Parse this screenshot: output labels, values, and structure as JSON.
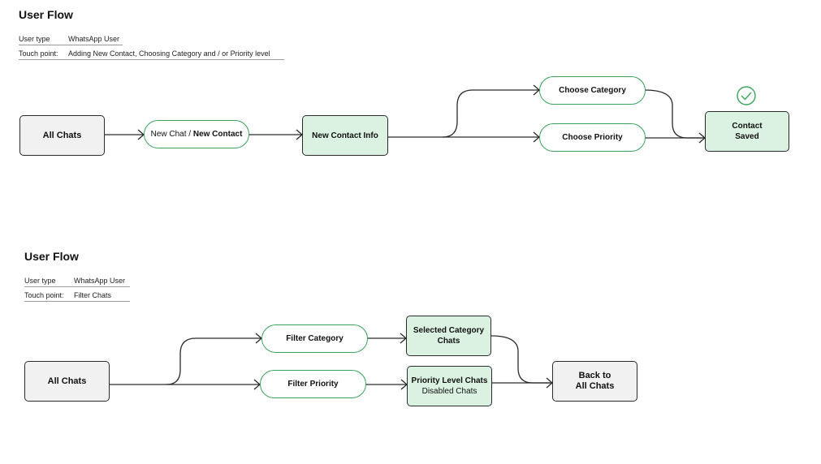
{
  "flows": [
    {
      "title": "User Flow",
      "user_type_label": "User type",
      "user_type_value": "WhatsApp User",
      "touch_point_label": "Touch point:",
      "touch_point_value": "Adding New Contact, Choosing Category and / or Priority level",
      "nodes": {
        "all_chats": "All Chats",
        "new_chat_prefix": "New Chat / ",
        "new_chat_bold": "New Contact",
        "new_contact_info": "New Contact Info",
        "choose_category": "Choose Category",
        "choose_priority": "Choose Priority",
        "contact_saved_line1": "Contact",
        "contact_saved_line2": "Saved"
      },
      "success_icon": "check-circle-icon"
    },
    {
      "title": "User Flow",
      "user_type_label": "User type",
      "user_type_value": "WhatsApp User",
      "touch_point_label": "Touch point:",
      "touch_point_value": "Filter Chats",
      "nodes": {
        "all_chats": "All Chats",
        "filter_category": "Filter Category",
        "filter_priority": "Filter Priority",
        "selected_category_line1": "Selected Category",
        "selected_category_line2": "Chats",
        "priority_level_chats": "Priority Level Chats",
        "disabled_chats": "Disabled Chats",
        "back_line1": "Back to",
        "back_line2": "All Chats"
      }
    }
  ],
  "colors": {
    "accent_green": "#3aa35c",
    "green_fill": "#dbf2e2",
    "gray_fill": "#f1f1f1",
    "stroke": "#2a2a2a"
  }
}
